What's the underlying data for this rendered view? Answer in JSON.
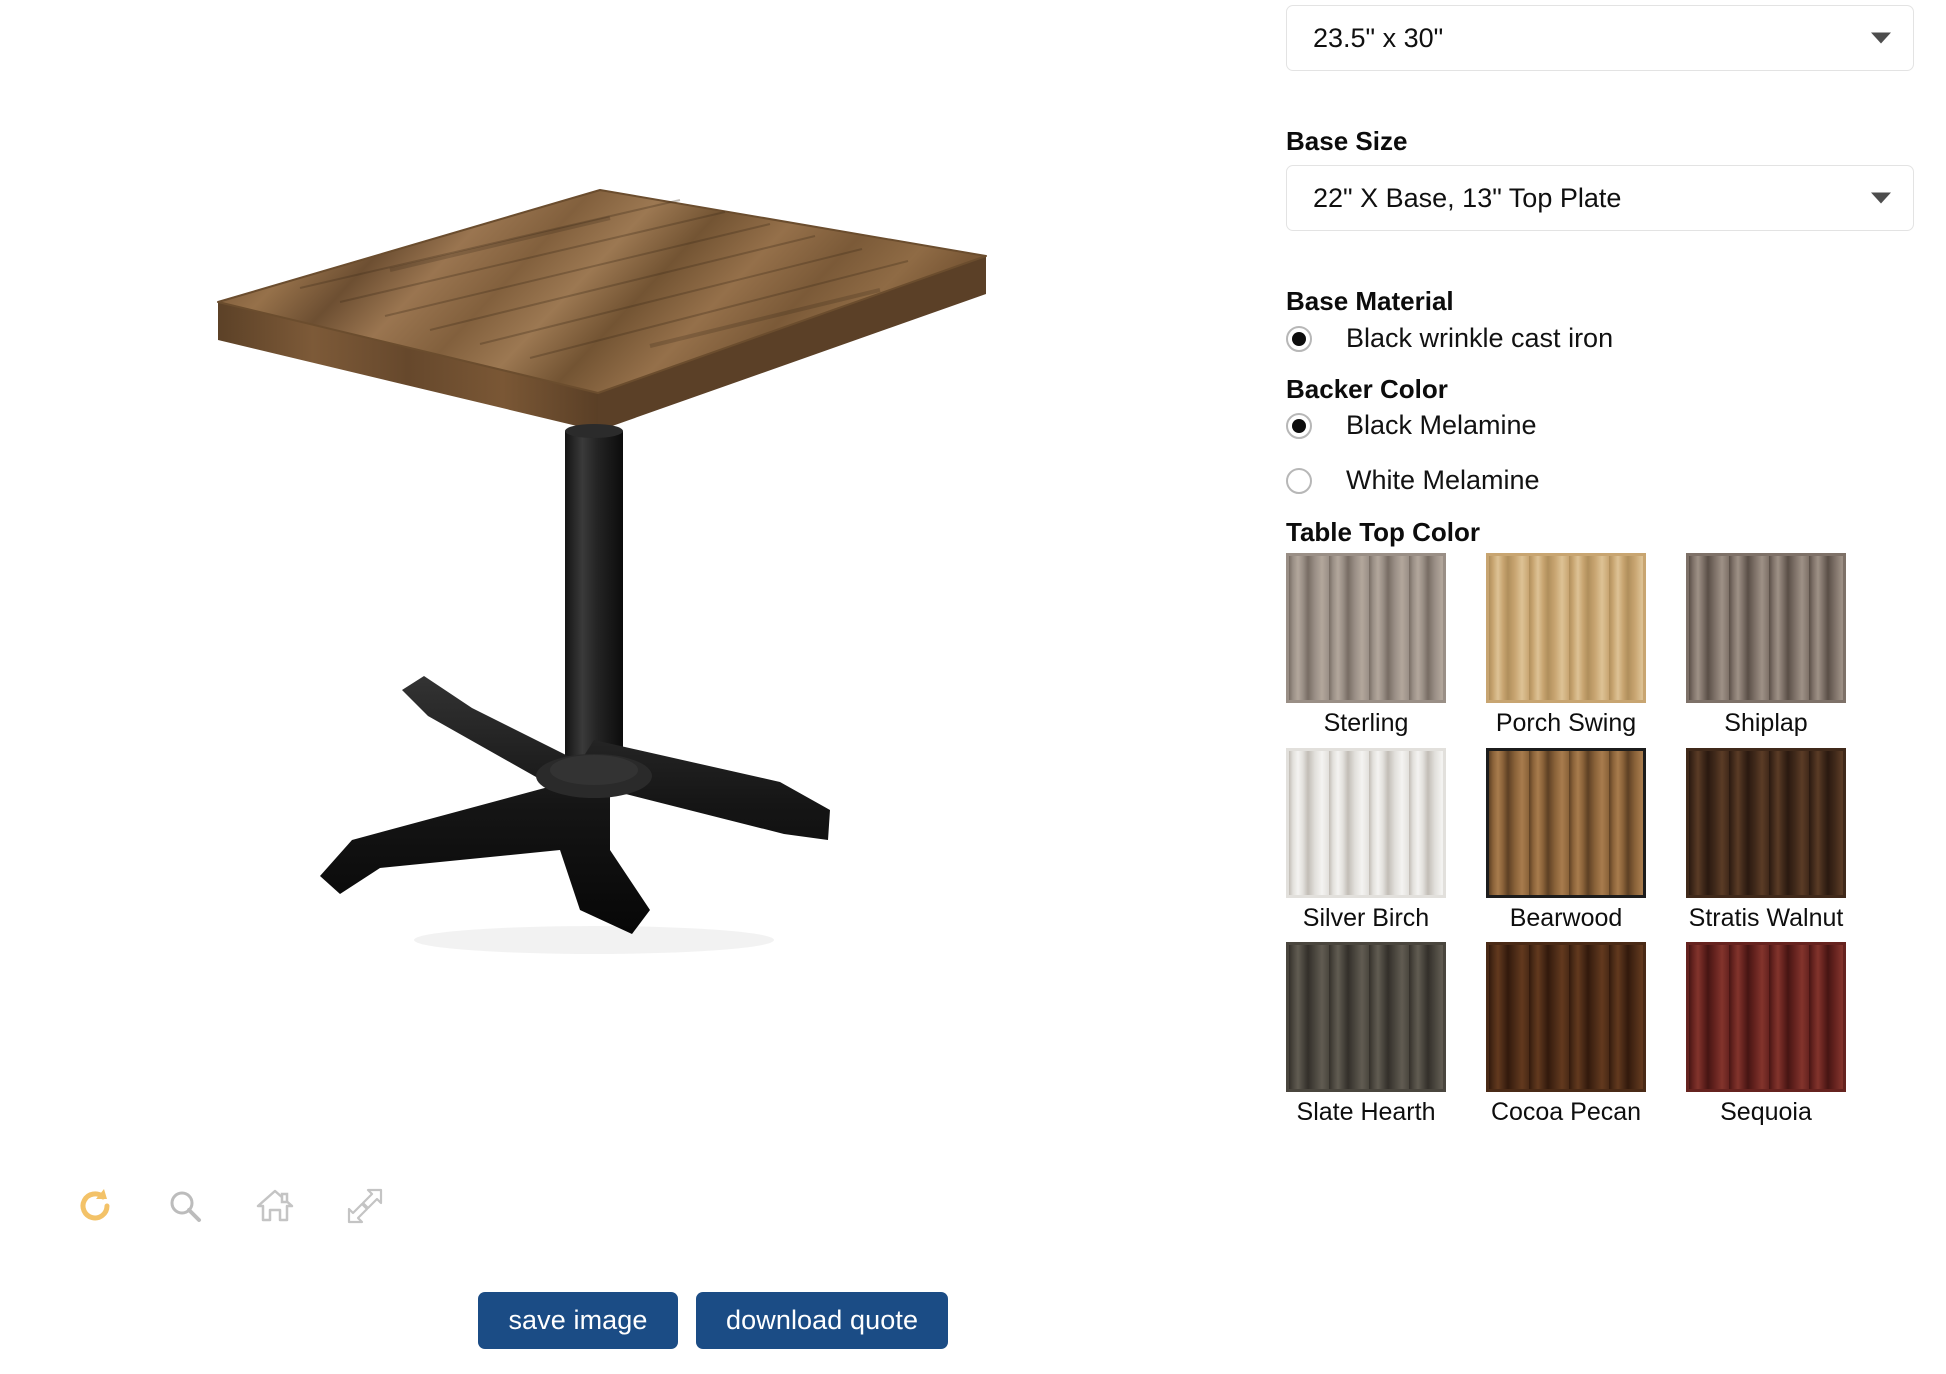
{
  "viewer": {
    "product_alt": "square wood-top table with black cast iron X base",
    "toolbar": [
      {
        "name": "rotate-icon",
        "label": "rotate",
        "color": "#f3c268"
      },
      {
        "name": "zoom-icon",
        "label": "zoom",
        "color": "#b9b9b9"
      },
      {
        "name": "home-icon",
        "label": "home",
        "color": "#b9b9b9"
      },
      {
        "name": "fullscreen-icon",
        "label": "fullscreen",
        "color": "#b9b9b9"
      }
    ],
    "actions": {
      "save_label": "save image",
      "download_label": "download quote",
      "button_color": "#1b4c85"
    }
  },
  "options": {
    "table_size": {
      "value": "23.5\" x 30\""
    },
    "base_size": {
      "label": "Base Size",
      "value": "22\" X Base, 13\" Top Plate"
    },
    "base_material": {
      "label": "Base Material",
      "items": [
        {
          "label": "Black wrinkle cast iron",
          "checked": true
        }
      ]
    },
    "backer_color": {
      "label": "Backer Color",
      "items": [
        {
          "label": "Black Melamine",
          "checked": true
        },
        {
          "label": "White Melamine",
          "checked": false
        }
      ]
    },
    "table_top_color": {
      "label": "Table Top Color",
      "selected": "Bearwood",
      "swatches": [
        {
          "name": "Sterling",
          "selected": false,
          "base": "#9a8f86",
          "dark": "#786d64",
          "light": "#b3a79c"
        },
        {
          "name": "Porch Swing",
          "selected": false,
          "base": "#c8a571",
          "dark": "#b08f5c",
          "light": "#ddc295"
        },
        {
          "name": "Shiplap",
          "selected": false,
          "base": "#7e7168",
          "dark": "#5a4f47",
          "light": "#9e9186"
        },
        {
          "name": "Silver Birch",
          "selected": false,
          "base": "#e2e0dc",
          "dark": "#c2bdb6",
          "light": "#f4f3f1"
        },
        {
          "name": "Bearwood",
          "selected": true,
          "base": "#8a6239",
          "dark": "#5d4024",
          "light": "#a87c4d"
        },
        {
          "name": "Stratis Walnut",
          "selected": false,
          "base": "#40291a",
          "dark": "#2a1910",
          "light": "#5b3c26"
        },
        {
          "name": "Slate Hearth",
          "selected": false,
          "base": "#4a463e",
          "dark": "#332f2a",
          "light": "#615c52"
        },
        {
          "name": "Cocoa Pecan",
          "selected": false,
          "base": "#4a2a16",
          "dark": "#32190c",
          "light": "#63391e"
        },
        {
          "name": "Sequoia",
          "selected": false,
          "base": "#66231f",
          "dark": "#461513",
          "light": "#83342c"
        }
      ]
    }
  }
}
